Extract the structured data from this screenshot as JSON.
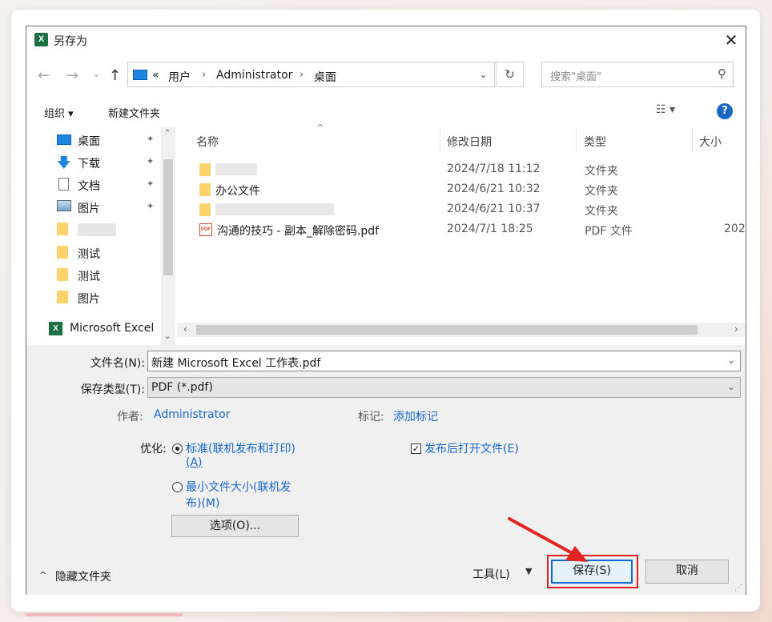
{
  "dialog": {
    "title": "另存为",
    "app_icon_letter": "X",
    "close_symbol": "✕"
  },
  "nav": {
    "back": "←",
    "forward": "→",
    "recent": "⌄",
    "up": "↑"
  },
  "address": {
    "overflow": "«",
    "crumbs": [
      "用户",
      "Administrator",
      "桌面"
    ],
    "separator": "›"
  },
  "search": {
    "placeholder": "搜索\"桌面\""
  },
  "toolbar": {
    "organize": "组织 ▾",
    "new_folder": "新建文件夹",
    "view_symbol": "☷ ▾",
    "help": "?"
  },
  "navpane": {
    "items": [
      {
        "label": "桌面",
        "pinned": true,
        "icon": "desktop-icon"
      },
      {
        "label": "下载",
        "pinned": true,
        "icon": "download-icon"
      },
      {
        "label": "文档",
        "pinned": true,
        "icon": "document-icon"
      },
      {
        "label": "图片",
        "pinned": true,
        "icon": "pictures-icon"
      },
      {
        "label": "",
        "pinned": false,
        "icon": "folder-icon"
      },
      {
        "label": "测试",
        "pinned": false,
        "icon": "folder-icon"
      },
      {
        "label": "测试",
        "pinned": false,
        "icon": "folder-icon"
      },
      {
        "label": "图片",
        "pinned": false,
        "icon": "folder-icon"
      },
      {
        "label": "Microsoft Excel",
        "pinned": false,
        "icon": "excel-icon"
      }
    ],
    "pin_symbol": "📌"
  },
  "files": {
    "columns": [
      "名称",
      "修改日期",
      "类型",
      "大小"
    ],
    "sort_arrow": "^",
    "rows": [
      {
        "name": "",
        "date": "2024/7/18 11:12",
        "type": "文件夹",
        "size": "",
        "icon": "folder-icon"
      },
      {
        "name": "办公文件",
        "date": "2024/6/21 10:32",
        "type": "文件夹",
        "size": "",
        "icon": "folder-icon"
      },
      {
        "name": "",
        "date": "2024/6/21 10:37",
        "type": "文件夹",
        "size": "",
        "icon": "folder-icon"
      },
      {
        "name": "沟通的技巧 - 副本_解除密码.pdf",
        "date": "2024/7/1 18:25",
        "type": "PDF 文件",
        "size": "202",
        "icon": "pdf-icon"
      }
    ],
    "pdf_icon_text": "PDF"
  },
  "form": {
    "filename_label": "文件名(N):",
    "filename_value": "新建 Microsoft Excel 工作表.pdf",
    "filetype_label": "保存类型(T):",
    "filetype_value": "PDF (*.pdf)",
    "author_label": "作者:",
    "author_value": "Administrator",
    "tags_label": "标记:",
    "tags_value": "添加标记",
    "optimize_label": "优化:",
    "opt_standard_line1": "标准(联机发布和打印)",
    "opt_standard_line2": "(A)",
    "opt_min_line1": "最小文件大小(联机发",
    "opt_min_line2": "布)(M)",
    "open_after_publish": "发布后打开文件(E)",
    "options_button": "选项(O)...",
    "hide_folders": "隐藏文件夹",
    "tools": "工具(L)",
    "save": "保存(S)",
    "cancel": "取消"
  }
}
